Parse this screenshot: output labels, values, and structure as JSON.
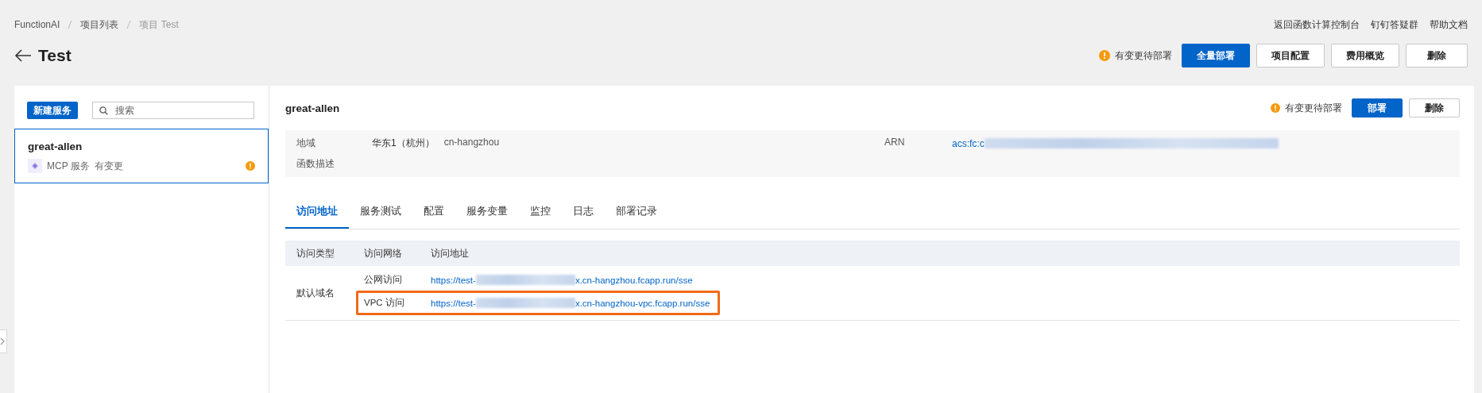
{
  "breadcrumb": [
    {
      "label": "FunctionAI",
      "current": false
    },
    {
      "label": "项目列表",
      "current": false
    },
    {
      "label": "项目 Test",
      "current": true
    }
  ],
  "top_links": [
    "返回函数计算控制台",
    "钉钉答疑群",
    "帮助文档"
  ],
  "page": {
    "title": "Test",
    "notice": "有变更待部署",
    "buttons": [
      {
        "label": "全量部署",
        "primary": true
      },
      {
        "label": "项目配置",
        "primary": false
      },
      {
        "label": "费用概览",
        "primary": false
      },
      {
        "label": "删除",
        "primary": false
      }
    ]
  },
  "sidebar": {
    "new_button": "新建服务",
    "search": {
      "placeholder": "搜索"
    },
    "items": [
      {
        "name": "great-allen",
        "type": "MCP 服务",
        "status": "有变更",
        "warning": true,
        "selected": true
      }
    ]
  },
  "service": {
    "name": "great-allen",
    "notice": "有变更待部署",
    "buttons": [
      {
        "label": "部署",
        "primary": true
      },
      {
        "label": "删除",
        "primary": false
      }
    ],
    "info": {
      "region_label": "地域",
      "region": "华东1（杭州）",
      "region_id": "cn-hangzhou",
      "arn_label": "ARN",
      "arn_prefix": "acs:fc:c",
      "description_label": "函数描述"
    },
    "tabs": [
      {
        "label": "访问地址",
        "selected": true
      },
      {
        "label": "服务测试",
        "selected": false
      },
      {
        "label": "配置",
        "selected": false
      },
      {
        "label": "服务变量",
        "selected": false
      },
      {
        "label": "监控",
        "selected": false
      },
      {
        "label": "日志",
        "selected": false
      },
      {
        "label": "部署记录",
        "selected": false
      }
    ],
    "table": {
      "columns": [
        "访问类型",
        "访问网络",
        "访问地址"
      ],
      "rows": [
        {
          "type": "默认域名",
          "entries": [
            {
              "network": "公网访问",
              "url_start": "https://test-",
              "url_end": "x.cn-hangzhou.fcapp.run/sse",
              "highlighted": false
            },
            {
              "network": "VPC 访问",
              "url_start": "https://test-",
              "url_end": "x.cn-hangzhou-vpc.fcapp.run/sse",
              "highlighted": true
            }
          ]
        }
      ]
    }
  }
}
